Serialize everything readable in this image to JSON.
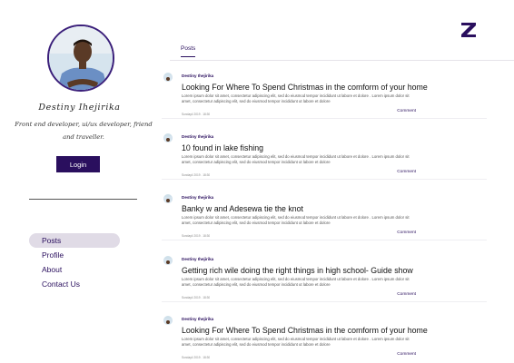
{
  "sidebar": {
    "profile_name": "Destiny Ihejirika",
    "bio": "Front end developer, ui/ux developer, friend and traveller.",
    "login_label": "Login",
    "nav": [
      "Posts",
      "Profile",
      "About",
      "Contact Us"
    ],
    "active_nav": "Posts"
  },
  "header": {
    "tab_label": "Posts"
  },
  "posts": [
    {
      "author": "Destiny Ihejirika",
      "title": "Looking For Where To Spend Christmas in the comform of your home",
      "body": "Lorem ipsum dolor sit amet, consectetur adipiscing elit, sed do eiusmod tempor incididunt ut labore et dolore . Lorem ipsum dolor sit amet, consectetur adipiscing elit, sed do eiusmod tempor incididunt ut labore et dolore",
      "date": "Sunday4 2019 . 18:30",
      "comment_label": "Comment"
    },
    {
      "author": "Destiny Ihejirika",
      "title": "10 found in lake fishing",
      "body": "Lorem ipsum dolor sit amet, consectetur adipiscing elit, sed do eiusmod tempor incididunt ut labore et dolore . Lorem ipsum dolor sit amet, consectetur adipiscing elit, sed do eiusmod tempor incididunt ut labore et dolore",
      "date": "Sunday4 2019 . 18:30",
      "comment_label": "Comment"
    },
    {
      "author": "Destiny Ihejirika",
      "title": "Banky w and Adesewa tie the knot",
      "body": "Lorem ipsum dolor sit amet, consectetur adipiscing elit, sed do eiusmod tempor incididunt ut labore et dolore . Lorem ipsum dolor sit amet, consectetur adipiscing elit, sed do eiusmod tempor incididunt ut labore et dolore",
      "date": "Sunday4 2019 . 18:30",
      "comment_label": "Comment"
    },
    {
      "author": "Destiny Ihejirika",
      "title": "Getting rich wile doing the right things in high school- Guide show",
      "body": "Lorem ipsum dolor sit amet, consectetur adipiscing elit, sed do eiusmod tempor incididunt ut labore et dolore . Lorem ipsum dolor sit amet, consectetur adipiscing elit, sed do eiusmod tempor incididunt ut labore et dolore",
      "date": "Sunday4 2019 . 18:30",
      "comment_label": "Comment"
    },
    {
      "author": "Destiny Ihejirika",
      "title": "Looking For Where To Spend Christmas in the comform of your home",
      "body": "Lorem ipsum dolor sit amet, consectetur adipiscing elit, sed do eiusmod tempor incididunt ut labore et dolore . Lorem ipsum dolor sit amet, consectetur adipiscing elit, sed do eiusmod tempor incididunt ut labore et dolore",
      "date": "Sunday4 2019 . 18:30",
      "comment_label": "Comment"
    }
  ],
  "colors": {
    "accent": "#2a0f5e",
    "nav_active_bg": "#e0dbe6"
  },
  "icons": {
    "logo": "z-logo-icon",
    "avatar": "profile-photo"
  }
}
